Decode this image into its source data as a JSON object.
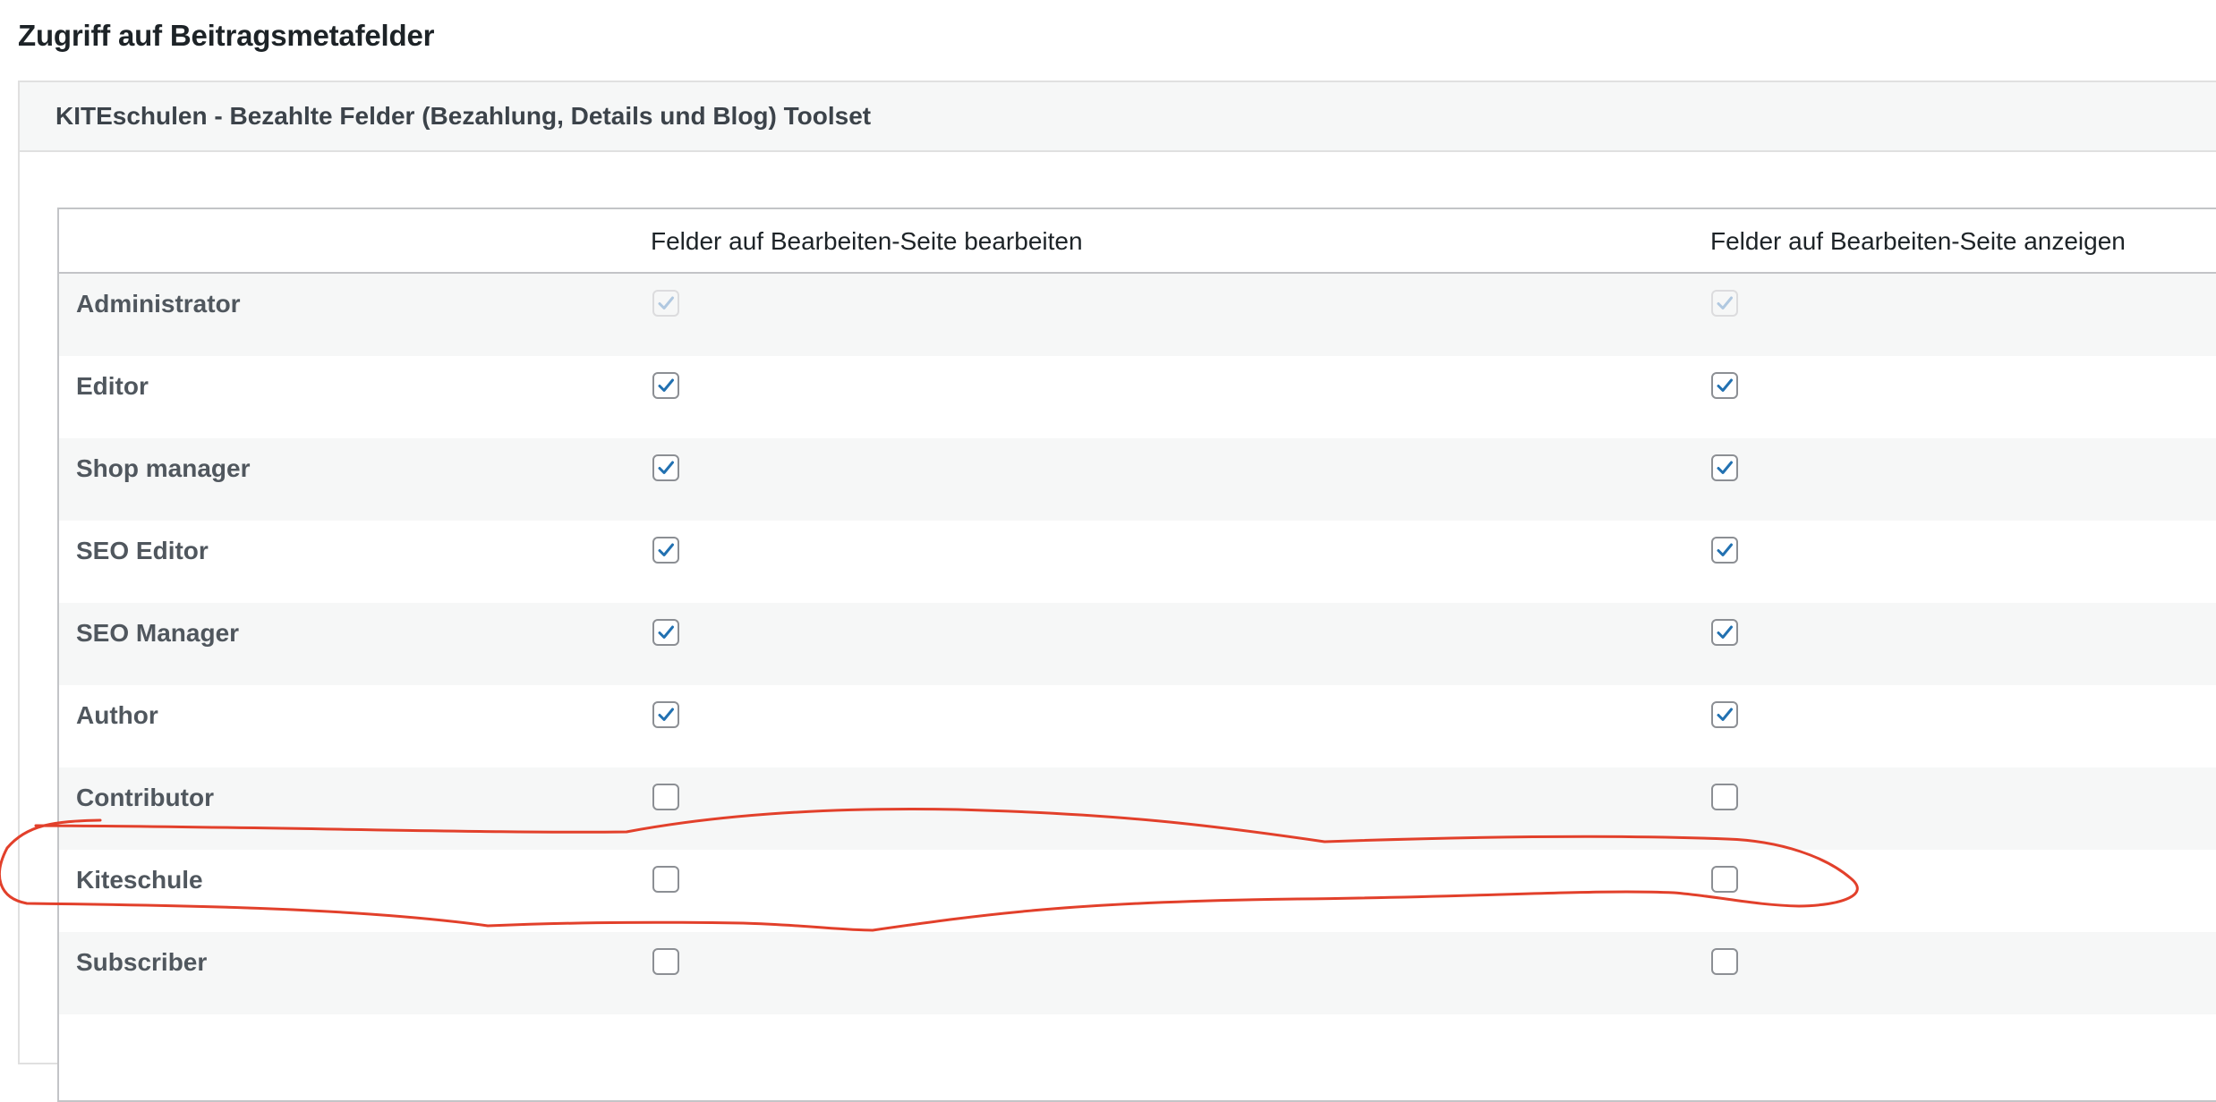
{
  "page": {
    "title": "Zugriff auf Beitragsmetafelder"
  },
  "panel": {
    "title": "KITEschulen - Bezahlte Felder (Bezahlung, Details und Blog) Toolset"
  },
  "table": {
    "columns": [
      "",
      "Felder auf Bearbeiten-Seite bearbeiten",
      "Felder auf Bearbeiten-Seite anzeigen"
    ],
    "rows": [
      {
        "role": "Administrator",
        "edit": true,
        "view": true,
        "disabled": true
      },
      {
        "role": "Editor",
        "edit": true,
        "view": true,
        "disabled": false
      },
      {
        "role": "Shop manager",
        "edit": true,
        "view": true,
        "disabled": false
      },
      {
        "role": "SEO Editor",
        "edit": true,
        "view": true,
        "disabled": false
      },
      {
        "role": "SEO Manager",
        "edit": true,
        "view": true,
        "disabled": false
      },
      {
        "role": "Author",
        "edit": true,
        "view": true,
        "disabled": false
      },
      {
        "role": "Contributor",
        "edit": false,
        "view": false,
        "disabled": false
      },
      {
        "role": "Kiteschule",
        "edit": false,
        "view": false,
        "disabled": false
      },
      {
        "role": "Subscriber",
        "edit": false,
        "view": false,
        "disabled": false
      }
    ]
  },
  "colors": {
    "checkmark": "#2271b1",
    "annotation": "#e2402b",
    "row_alt": "#f6f7f7"
  },
  "icons": {
    "checked": "checkmark-icon",
    "annotation": "hand-drawn-circle"
  }
}
